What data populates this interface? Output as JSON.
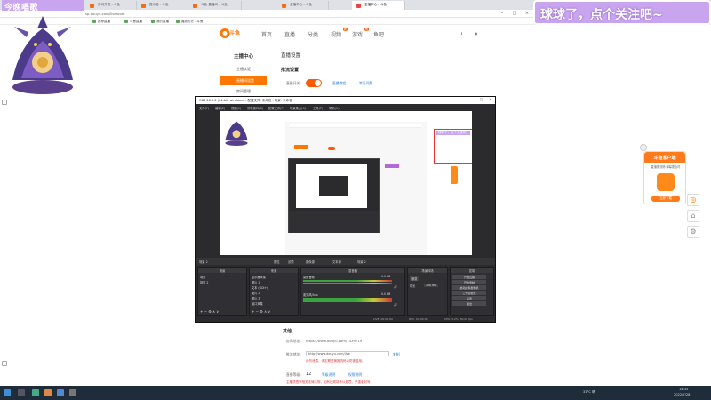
{
  "browser": {
    "tabs": [
      {
        "label": "房间开发 - 斗鱼",
        "active": false
      },
      {
        "label": "提示名 - 斗鱼",
        "active": false
      },
      {
        "label": "斗鱼 直播间 - 斗鱼",
        "active": false
      },
      {
        "label": "主播中心 - 斗鱼",
        "active": true
      }
    ],
    "url": "sp.douyu.com/liveroom",
    "bookmarks": [
      "推荐直播",
      "斗鱼直播",
      "我的直播",
      "播放历史 - 斗鱼"
    ]
  },
  "overlay": {
    "left_title": "今晚唱歌",
    "right_banner": "球球了，点个关注吧~"
  },
  "header": {
    "logo": "斗鱼",
    "nav": [
      "首页",
      "直播",
      "分类",
      "视频",
      "游戏",
      "鱼吧"
    ],
    "video_badge": "新",
    "game_badge": "热"
  },
  "sidebar": {
    "title": "主播中心",
    "items": [
      {
        "label": "主播认证",
        "active": false
      },
      {
        "label": "直播间设置",
        "active": true
      },
      {
        "label": "房间管理",
        "active": false
      }
    ]
  },
  "main": {
    "section_title": "直播设置",
    "subtitle": "推流设置",
    "toggle_label": "直播开关：",
    "link1": "直播教程",
    "link2": "常见问题",
    "other_title": "其他",
    "room_addr_label": "房间地址：",
    "room_addr_value": "https://www.douyu.com/7439719",
    "push_label": "推流地址：",
    "push_value": "http://www.douyu.com/live",
    "push_btn": "复制",
    "push_note": "请勿泄露，请定期更换推流码以防被盗用。",
    "level_label": "直播等级：",
    "level_value": "12",
    "level_link1": "等级说明",
    "level_link2": "权限说明",
    "warn_note": "主播须遵守相关法律法规，如有违规将予以处罚，严重者封号。"
  },
  "obs": {
    "title": "OBS 28.0.2 (64-bit, windows) - 配置文件: 未命名 - 场景: 未命名",
    "menu": [
      "文件(F)",
      "编辑(E)",
      "视图(V)",
      "停靠窗口(D)",
      "配置文件(P)",
      "场景集合(S)",
      "工具(T)",
      "帮助(H)"
    ],
    "red_box_label": "球球了，点个关注吧~",
    "status_chips": [
      "场景 2",
      "属性",
      "滤镜",
      "图像源",
      "文本源",
      "场景 2"
    ],
    "docks": {
      "scenes_title": "场景",
      "scenes": [
        "场景",
        "场景 2"
      ],
      "sources_title": "来源",
      "sources": [
        "显示器采集",
        "图片 1",
        "文本 (GDI+)",
        "图片 2",
        "图片 3",
        "窗口采集"
      ],
      "mixer_title": "混音器",
      "mixer_tracks": [
        "桌面音频",
        "麦克风/Aux"
      ],
      "mixer_levels": [
        "0.0 dB",
        "0.0 dB"
      ],
      "transition_title": "场景转场",
      "transition_value": "渐变",
      "duration_label": "时长",
      "duration_value": "300 ms",
      "controls_title": "控制",
      "controls": [
        "开始直播",
        "开始录制",
        "启动虚拟摄像机",
        "工作室模式",
        "设置",
        "退出"
      ]
    },
    "bottom": [
      "LIVE: 00:00:00",
      "REC: 00:00:00",
      "CPU: 3.2%, 30.00 fps"
    ]
  },
  "promo": {
    "head": "斗鱼客户端",
    "sub": "直播更流畅 弹幕更及时",
    "button": "立即下载"
  },
  "taskbar": {
    "weather": "31°C 晴",
    "time": "14:35",
    "date": "2022/7/28"
  },
  "colors": {
    "accent": "#ff7700",
    "overlay_purple": "#c9a5f0",
    "obs_bg": "#2b2b2e"
  }
}
